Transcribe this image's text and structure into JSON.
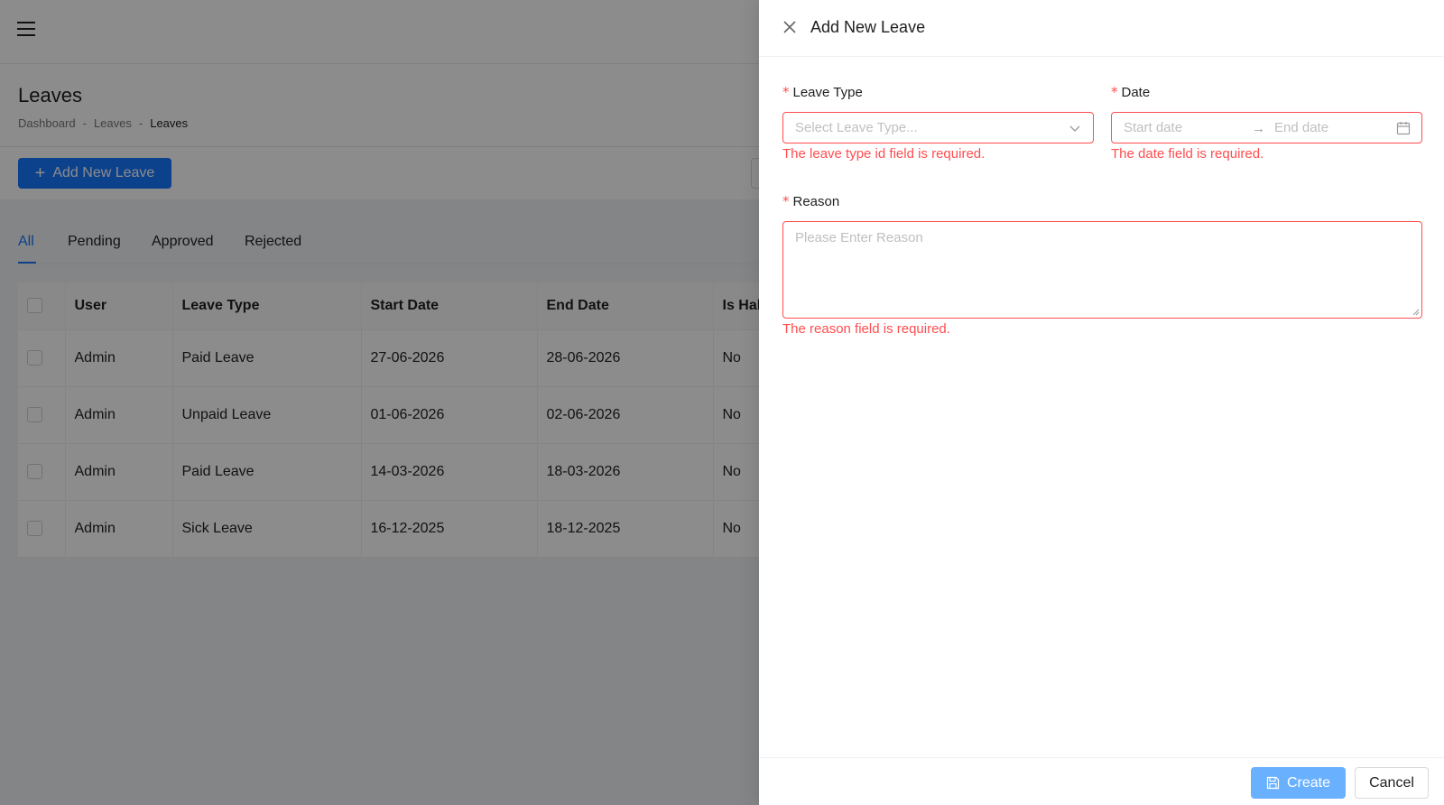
{
  "page": {
    "title": "Leaves",
    "breadcrumb": [
      "Dashboard",
      "-",
      "Leaves",
      "-",
      "Leaves"
    ],
    "add_button_label": "Add New Leave",
    "tabs": [
      {
        "label": "All",
        "active": true
      },
      {
        "label": "Pending",
        "active": false
      },
      {
        "label": "Approved",
        "active": false
      },
      {
        "label": "Rejected",
        "active": false
      }
    ],
    "table": {
      "headers": [
        "User",
        "Leave Type",
        "Start Date",
        "End Date",
        "Is Hal"
      ],
      "rows": [
        [
          "Admin",
          "Paid Leave",
          "27-06-2026",
          "28-06-2026",
          "No"
        ],
        [
          "Admin",
          "Unpaid Leave",
          "01-06-2026",
          "02-06-2026",
          "No"
        ],
        [
          "Admin",
          "Paid Leave",
          "14-03-2026",
          "18-03-2026",
          "No"
        ],
        [
          "Admin",
          "Sick Leave",
          "16-12-2025",
          "18-12-2025",
          "No"
        ]
      ]
    }
  },
  "drawer": {
    "title": "Add New Leave",
    "leave_type": {
      "label": "Leave Type",
      "placeholder": "Select Leave Type...",
      "error": "The leave type id field is required."
    },
    "date": {
      "label": "Date",
      "start_placeholder": "Start date",
      "separator": "→",
      "end_placeholder": "End date",
      "error": "The date field is required."
    },
    "reason": {
      "label": "Reason",
      "placeholder": "Please Enter Reason",
      "error": "The reason field is required."
    },
    "required_mark": "*",
    "create_label": "Create",
    "cancel_label": "Cancel"
  },
  "colors": {
    "primary": "#1677ff",
    "error": "#ff4d4f",
    "create_button": "#69b1ff"
  },
  "icons": {
    "menu": "hamburger-icon",
    "add": "plus-icon",
    "close": "close-icon",
    "select": "chevron-down-icon",
    "date_range": "arrow-right-icon",
    "calendar": "calendar-icon",
    "save": "save-icon"
  }
}
